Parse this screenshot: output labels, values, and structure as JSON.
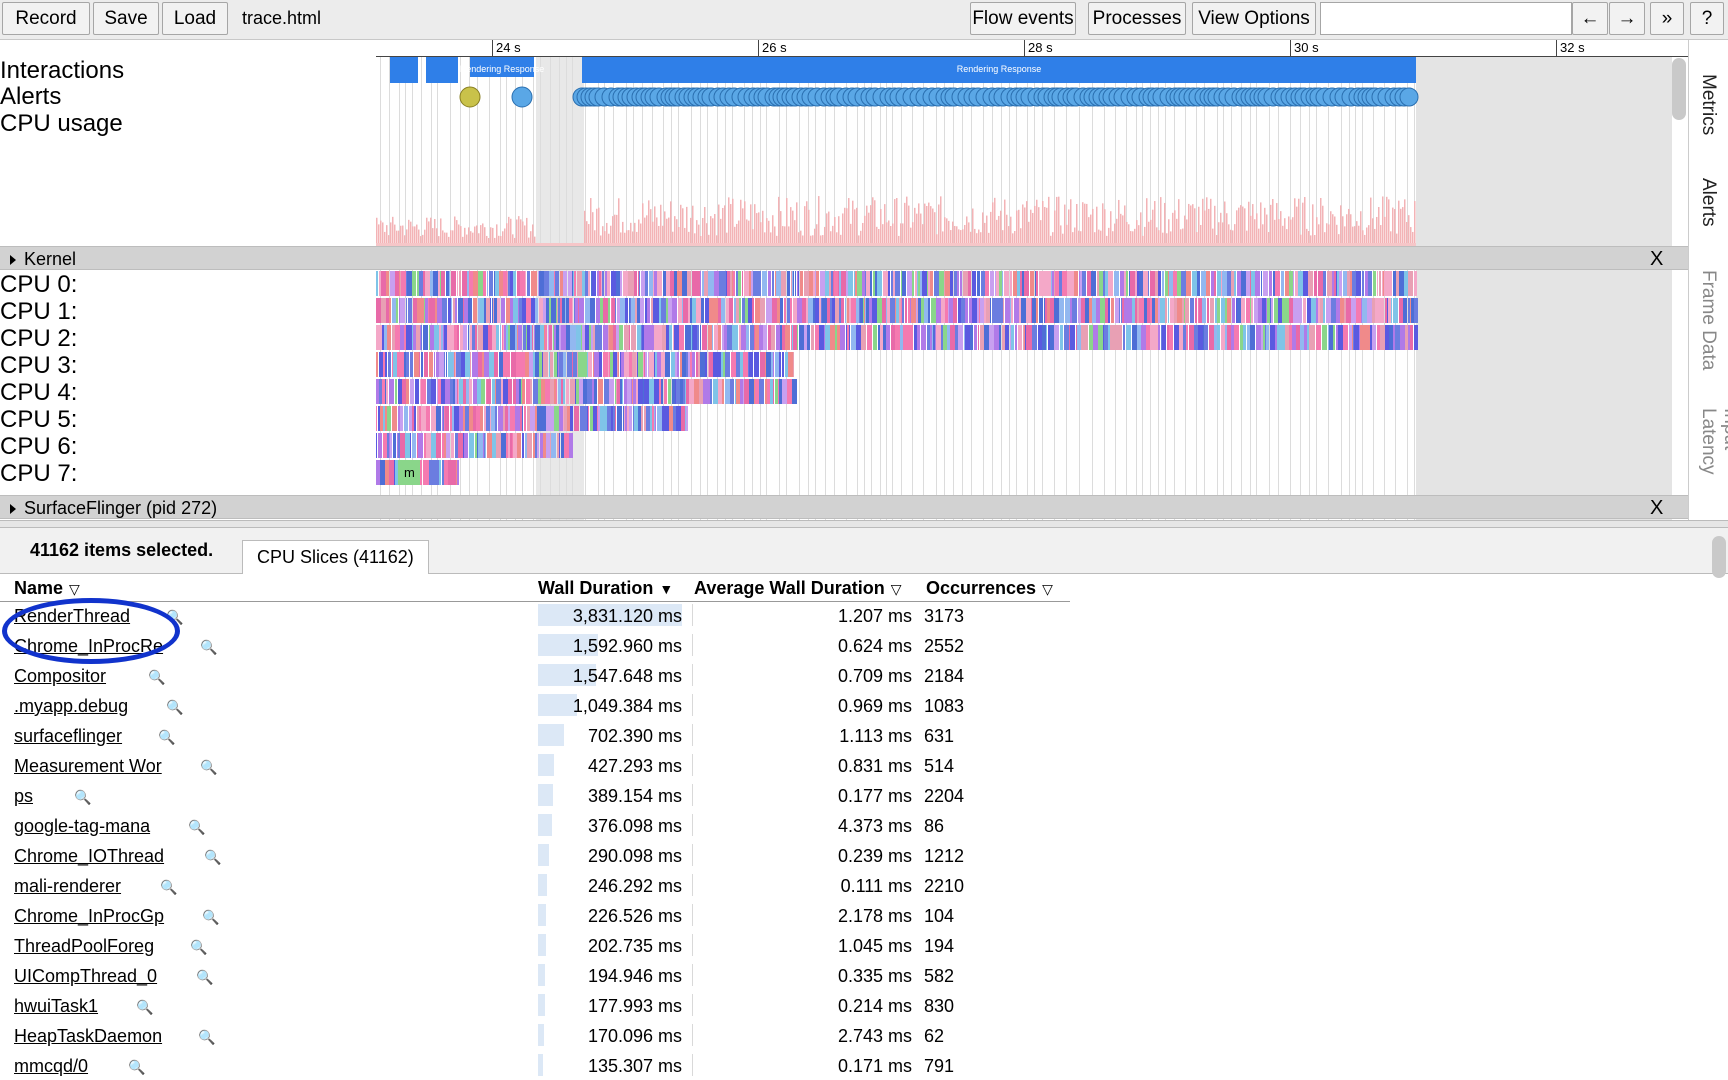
{
  "toolbar": {
    "record": "Record",
    "save": "Save",
    "load": "Load",
    "filename": "trace.html",
    "flow_events": "Flow events",
    "processes": "Processes",
    "view_options": "View Options",
    "search_value": "",
    "prev_arrow": "←",
    "next_arrow": "→",
    "more": "»",
    "help": "?"
  },
  "ruler_labels": [
    "24 s",
    "26 s",
    "28 s",
    "30 s",
    "32 s"
  ],
  "tracks": {
    "interactions": "Interactions",
    "alerts": "Alerts",
    "cpu_usage": "CPU usage",
    "kernel": "Kernel",
    "cpus": [
      "CPU 0:",
      "CPU 1:",
      "CPU 2:",
      "CPU 3:",
      "CPU 4:",
      "CPU 5:",
      "CPU 6:",
      "CPU 7:"
    ],
    "surfaceflinger": "SurfaceFlinger (pid 272)",
    "close": "X",
    "interaction_label": "Rendering Response",
    "cpu7_slice_label": "m"
  },
  "side_tabs": [
    "Metrics",
    "Alerts",
    "Frame Data",
    "Input Latency"
  ],
  "panel": {
    "selected": "41162 items selected.",
    "tab": "CPU Slices (41162)"
  },
  "table": {
    "headers": {
      "name": "Name",
      "wall": "Wall Duration",
      "avg": "Average Wall Duration",
      "occ": "Occurrences"
    },
    "rows": [
      {
        "name": "RenderThread",
        "wall": "3,831.120 ms",
        "wall_fraction": 1.0,
        "avg": "1.207 ms",
        "occ": "3173"
      },
      {
        "name": "Chrome_InProcRe",
        "wall": "1,592.960 ms",
        "wall_fraction": 0.416,
        "avg": "0.624 ms",
        "occ": "2552"
      },
      {
        "name": "Compositor",
        "wall": "1,547.648 ms",
        "wall_fraction": 0.404,
        "avg": "0.709 ms",
        "occ": "2184"
      },
      {
        "name": ".myapp.debug",
        "wall": "1,049.384 ms",
        "wall_fraction": 0.274,
        "avg": "0.969 ms",
        "occ": "1083"
      },
      {
        "name": "surfaceflinger",
        "wall": "702.390 ms",
        "wall_fraction": 0.183,
        "avg": "1.113 ms",
        "occ": "631"
      },
      {
        "name": "Measurement Wor",
        "wall": "427.293 ms",
        "wall_fraction": 0.112,
        "avg": "0.831 ms",
        "occ": "514"
      },
      {
        "name": "ps",
        "wall": "389.154 ms",
        "wall_fraction": 0.102,
        "avg": "0.177 ms",
        "occ": "2204"
      },
      {
        "name": "google-tag-mana",
        "wall": "376.098 ms",
        "wall_fraction": 0.098,
        "avg": "4.373 ms",
        "occ": "86"
      },
      {
        "name": "Chrome_IOThread",
        "wall": "290.098 ms",
        "wall_fraction": 0.076,
        "avg": "0.239 ms",
        "occ": "1212"
      },
      {
        "name": "mali-renderer",
        "wall": "246.292 ms",
        "wall_fraction": 0.064,
        "avg": "0.111 ms",
        "occ": "2210"
      },
      {
        "name": "Chrome_InProcGp",
        "wall": "226.526 ms",
        "wall_fraction": 0.059,
        "avg": "2.178 ms",
        "occ": "104"
      },
      {
        "name": "ThreadPoolForeg",
        "wall": "202.735 ms",
        "wall_fraction": 0.053,
        "avg": "1.045 ms",
        "occ": "194"
      },
      {
        "name": "UICompThread_0",
        "wall": "194.946 ms",
        "wall_fraction": 0.051,
        "avg": "0.335 ms",
        "occ": "582"
      },
      {
        "name": "hwuiTask1",
        "wall": "177.993 ms",
        "wall_fraction": 0.046,
        "avg": "0.214 ms",
        "occ": "830"
      },
      {
        "name": "HeapTaskDaemon",
        "wall": "170.096 ms",
        "wall_fraction": 0.044,
        "avg": "2.743 ms",
        "occ": "62"
      },
      {
        "name": "mmcqd/0",
        "wall": "135.307 ms",
        "wall_fraction": 0.035,
        "avg": "0.171 ms",
        "occ": "791"
      }
    ]
  },
  "colors": {
    "accent": "#3b82f6",
    "interaction_bar": "#2f7fe8",
    "alert_warn": "#c9c24a",
    "alert_info": "#5aa7e6",
    "cpu_usage": "#f3b3b6",
    "highlight": "#1133cc"
  }
}
